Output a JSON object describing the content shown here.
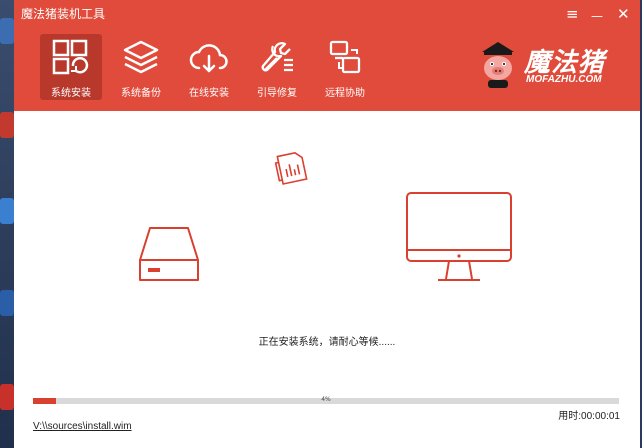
{
  "window": {
    "title": "魔法猪装机工具"
  },
  "controls": {
    "menu": "≡",
    "minimize": "—",
    "close": "✕"
  },
  "nav": {
    "items": [
      {
        "label": "系统安装",
        "icon": "windows-reinstall-icon",
        "active": true
      },
      {
        "label": "系统备份",
        "icon": "layers-icon",
        "active": false
      },
      {
        "label": "在线安装",
        "icon": "cloud-download-icon",
        "active": false
      },
      {
        "label": "引导修复",
        "icon": "wrench-icon",
        "active": false
      },
      {
        "label": "远程协助",
        "icon": "remote-screens-icon",
        "active": false
      }
    ]
  },
  "logo": {
    "cn": "魔法猪",
    "en": "MOFAZHU.COM"
  },
  "main": {
    "status": "正在安装系统，请耐心等候......",
    "progress": {
      "percent": 4,
      "label": "4%"
    },
    "elapsed": "用时:00:00:01",
    "path": "V:\\\\sources\\install.wim"
  },
  "colors": {
    "brand": "#e04b3b",
    "active": "#b8382c",
    "progress": "#d9402f"
  }
}
